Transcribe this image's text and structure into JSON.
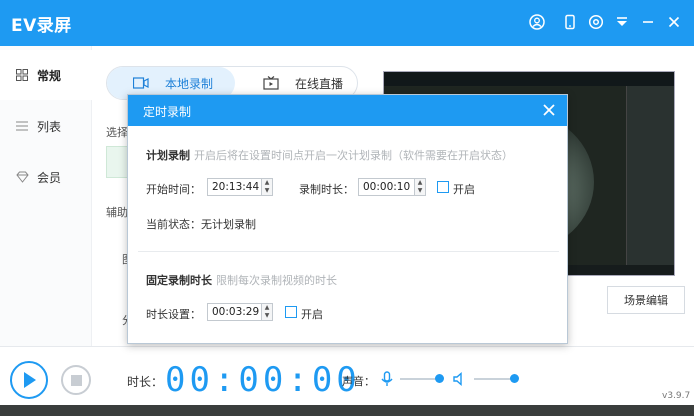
{
  "app": {
    "title": "EV录屏",
    "version": "v3.9.7"
  },
  "titlebar_icons": [
    "user-icon",
    "phone-icon",
    "settings-icon",
    "menu-icon",
    "minimize-icon",
    "close-icon"
  ],
  "sidebar": {
    "items": [
      {
        "label": "常规",
        "icon": "grid-icon",
        "active": true
      },
      {
        "label": "列表",
        "icon": "list-icon",
        "active": false
      },
      {
        "label": "会员",
        "icon": "diamond-icon",
        "active": false
      }
    ]
  },
  "tabs": [
    {
      "label": "本地录制",
      "icon": "record-icon",
      "active": true
    },
    {
      "label": "在线直播",
      "icon": "live-icon",
      "active": false
    }
  ],
  "background_texts": {
    "select": "选择",
    "assist": "辅助",
    "char1": "图",
    "char2": "分"
  },
  "scene_button": "场景编辑",
  "bottom": {
    "duration_label": "时长：",
    "timer": "00:00:00",
    "volume_label": "声音："
  },
  "dialog": {
    "title": "定时录制",
    "plan_section": {
      "title": "计划录制",
      "hint": "开启后将在设置时间点开启一次计划录制（软件需要在开启状态）"
    },
    "start_time_label": "开始时间：",
    "start_time_value": "20:13:44",
    "record_duration_label": "录制时长：",
    "record_duration_value": "00:00:10",
    "enable_label": "开启",
    "status_label": "当前状态：",
    "status_value": "无计划录制",
    "fixed_section": {
      "title": "固定录制时长",
      "hint": "限制每次录制视频的时长"
    },
    "duration_setting_label": "时长设置：",
    "duration_setting_value": "00:03:29",
    "enable_label_2": "开启"
  },
  "colors": {
    "accent": "#1e9af2",
    "title_bar": "#1e9af2",
    "tab_active_bg": "#e3f1fd"
  }
}
